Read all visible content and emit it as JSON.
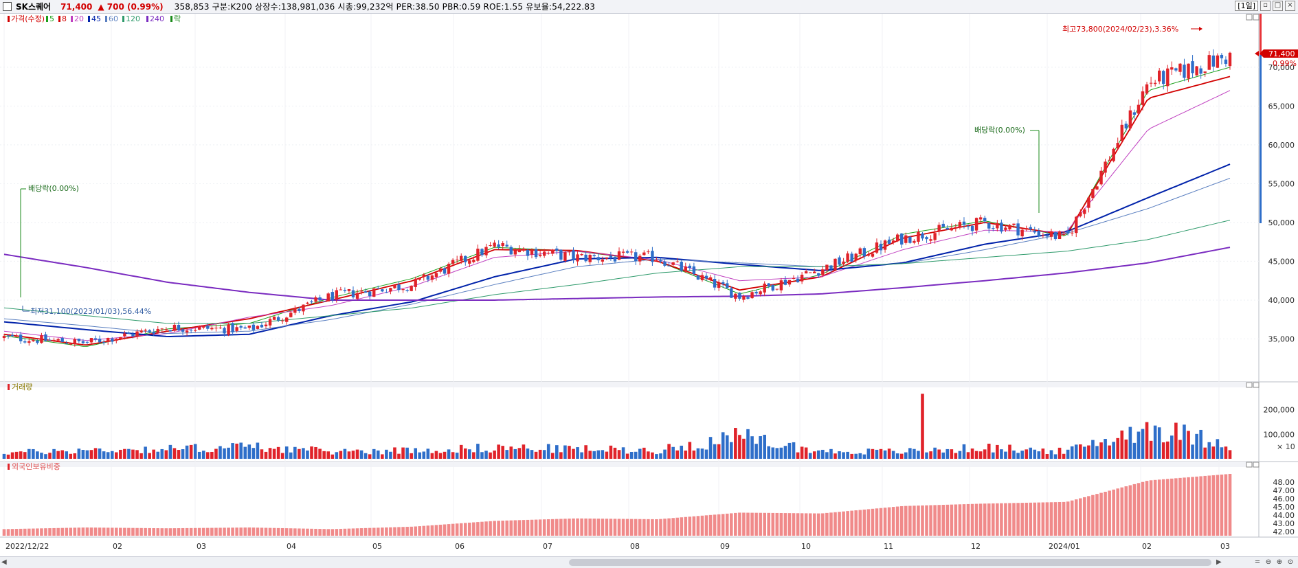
{
  "header": {
    "stock_name": "SK스퀘어",
    "price": "71,400",
    "change": "▲ 700",
    "change_pct": "(0.99%)",
    "info": "358,853  구분:K200 상장수:138,981,036 시총:99,232억 PER:38.50 PBR:0.59 ROE:1.55 유보율:54,222.83",
    "period": "[1일]"
  },
  "price_panel": {
    "legend": [
      {
        "label": "가격(수정)",
        "color": "#d20000"
      },
      {
        "label": "5",
        "color": "#1aa01a"
      },
      {
        "label": "8",
        "color": "#d20000"
      },
      {
        "label": "20",
        "color": "#c040c0"
      },
      {
        "label": "45",
        "color": "#0022aa"
      },
      {
        "label": "60",
        "color": "#5a7fc0"
      },
      {
        "label": "120",
        "color": "#2e9a6b"
      },
      {
        "label": "240",
        "color": "#7a2bc0"
      },
      {
        "label": "락",
        "color": "#1a8a1a"
      }
    ],
    "current_price_tag": "71,400",
    "current_pct_tag": "0.99%",
    "annotations": {
      "high": "최고73,800(2024/02/23),3.36%",
      "low": "최저31,100(2023/01/03),56.44%",
      "dividend1": "배당락(0.00%)",
      "dividend2": "배당락(0.00%)"
    }
  },
  "volume_panel": {
    "legend": "거래량",
    "unit_note": "× 10"
  },
  "foreign_panel": {
    "legend": "외국인보유비중"
  },
  "x_axis": {
    "labels": [
      "2022/12/22",
      "02",
      "03",
      "04",
      "05",
      "06",
      "07",
      "08",
      "09",
      "10",
      "11",
      "12",
      "2024/01",
      "02",
      "03"
    ]
  },
  "colors": {
    "up": "#e0232a",
    "down": "#2e6ec9",
    "background": "#ffffff"
  },
  "chart_data": [
    {
      "type": "candlestick",
      "title": "가격(수정)",
      "ylim": [
        30000,
        76000
      ],
      "y_ticks": [
        "35,000",
        "40,000",
        "45,000",
        "50,000",
        "55,000",
        "60,000",
        "65,000",
        "70,000"
      ],
      "x": [
        "2022/12",
        "2023/01",
        "2023/02",
        "2023/03",
        "2023/04",
        "2023/05",
        "2023/06",
        "2023/07",
        "2023/08",
        "2023/09",
        "2023/10",
        "2023/11",
        "2023/12",
        "2024/01",
        "2024/02",
        "2024/03"
      ],
      "close": [
        35200,
        34500,
        36500,
        36200,
        40500,
        42000,
        47000,
        45500,
        45500,
        40500,
        44000,
        48000,
        50000,
        48000,
        68000,
        71400
      ],
      "high": 73800,
      "high_date": "2024/02/23",
      "low": 31100,
      "low_date": "2023/01/03",
      "moving_averages": [
        {
          "name": "5",
          "values": [
            35400,
            34000,
            36300,
            37000,
            40300,
            42800,
            46800,
            46300,
            45000,
            40800,
            43300,
            48500,
            50200,
            48200,
            67000,
            70000
          ]
        },
        {
          "name": "8",
          "values": [
            35600,
            34200,
            36000,
            37600,
            40000,
            42500,
            46500,
            46400,
            45000,
            41300,
            43000,
            48000,
            50000,
            48400,
            66000,
            68800
          ]
        },
        {
          "name": "20",
          "values": [
            36000,
            34800,
            35700,
            37800,
            39300,
            41800,
            45500,
            46300,
            45200,
            42500,
            43000,
            46500,
            49000,
            48800,
            62000,
            67000
          ]
        },
        {
          "name": "45",
          "values": [
            37200,
            36200,
            35300,
            35600,
            38000,
            39800,
            43000,
            45300,
            45500,
            44600,
            43800,
            44800,
            47200,
            48800,
            53200,
            57500
          ]
        },
        {
          "name": "60",
          "values": [
            37600,
            36700,
            35700,
            36000,
            37500,
            39500,
            42000,
            44300,
            45300,
            44800,
            44300,
            44700,
            46500,
            48600,
            51800,
            55700
          ]
        },
        {
          "name": "120",
          "values": [
            39000,
            38000,
            37000,
            37000,
            38000,
            39000,
            40700,
            42000,
            43500,
            44300,
            44300,
            44700,
            45500,
            46300,
            47800,
            50300
          ]
        },
        {
          "name": "240",
          "values": [
            45900,
            44200,
            42300,
            41000,
            40000,
            40000,
            40000,
            40200,
            40400,
            40500,
            40800,
            41600,
            42500,
            43500,
            44800,
            46800
          ]
        }
      ]
    },
    {
      "type": "bar",
      "title": "거래량",
      "ylim": [
        0,
        280000
      ],
      "y_ticks": [
        "100,000",
        "200,000"
      ],
      "x": [
        "2022/12",
        "2023/01",
        "2023/02",
        "2023/03",
        "2023/04",
        "2023/05",
        "2023/06",
        "2023/07",
        "2023/08",
        "2023/09",
        "2023/10",
        "2023/11",
        "2023/12",
        "2024/01",
        "2024/02",
        "2024/03"
      ],
      "values": [
        25000,
        35000,
        40000,
        50000,
        30000,
        35000,
        45000,
        40000,
        35000,
        90000,
        30000,
        30000,
        45000,
        30000,
        130000,
        60000
      ],
      "max_value": 265000
    },
    {
      "type": "bar",
      "title": "외국인보유비중",
      "ylim": [
        41.5,
        49.5
      ],
      "y_ticks": [
        "42.00",
        "43.00",
        "44.00",
        "45.00",
        "46.00",
        "47.00",
        "48.00"
      ],
      "x": [
        "2022/12",
        "2023/01",
        "2023/02",
        "2023/03",
        "2023/04",
        "2023/05",
        "2023/06",
        "2023/07",
        "2023/08",
        "2023/09",
        "2023/10",
        "2023/11",
        "2023/12",
        "2024/01",
        "2024/02",
        "2024/03"
      ],
      "values": [
        42.3,
        42.5,
        42.4,
        42.5,
        42.3,
        42.6,
        43.3,
        43.6,
        43.5,
        44.3,
        44.2,
        45.1,
        45.4,
        45.6,
        48.2,
        49.0
      ]
    }
  ]
}
